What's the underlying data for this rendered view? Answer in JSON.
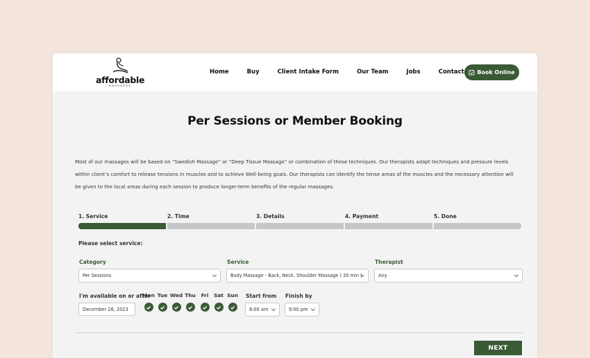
{
  "header": {
    "logo": {
      "word": "affordable",
      "sub": "MASSAGES"
    },
    "nav": [
      "Home",
      "Buy",
      "Client Intake Form",
      "Our Team",
      "Jobs",
      "Contact Us"
    ],
    "book_button": "Book Online"
  },
  "page": {
    "title": "Per Sessions or Member Booking",
    "description": "Most of our massages will be based on “Swedish Massage” or “Deep Tissue Massage” or combination of these techniques. Our therapists adapt techniques and pressure levels within client’s comfort to release tensions in muscles and to achieve Well-being goals. Our therapists can identify the tense areas of the muscles and the necessary attention will be given to the local areas during each session to produce longer-term benefits of the regular massages."
  },
  "steps": [
    {
      "label": "1. Service",
      "active": true
    },
    {
      "label": "2. Time",
      "active": false
    },
    {
      "label": "3. Details",
      "active": false
    },
    {
      "label": "4. Payment",
      "active": false
    },
    {
      "label": "5. Done",
      "active": false
    }
  ],
  "form": {
    "prompt": "Please select service:",
    "category": {
      "label": "Category",
      "value": "Per Sessions"
    },
    "service": {
      "label": "Service",
      "value": "Body Massage - Back, Neck. Shoulder Massage ( 30 min )"
    },
    "therapist": {
      "label": "Therapist",
      "value": "Any"
    },
    "available": {
      "label": "I'm available on or after",
      "value": "December 28, 2023"
    },
    "days": [
      "Mon",
      "Tue",
      "Wed",
      "Thu",
      "Fri",
      "Sat",
      "Sun"
    ],
    "start": {
      "label": "Start from",
      "value": "8:00 am"
    },
    "finish": {
      "label": "Finish by",
      "value": "9:00 pm"
    }
  },
  "actions": {
    "next": "NEXT"
  },
  "colors": {
    "accent": "#3a5a36",
    "background": "#f4e6dc",
    "card": "#f3f3f3",
    "inactive_step": "#c4c6c8"
  }
}
